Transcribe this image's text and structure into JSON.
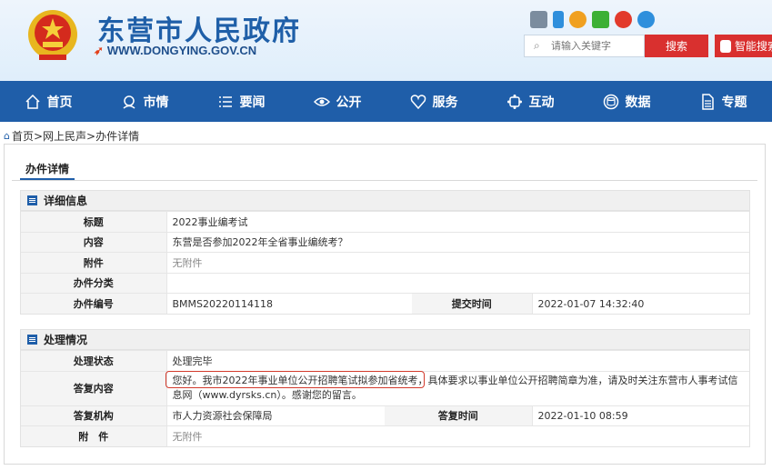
{
  "header": {
    "site_title": "东营市人民政府",
    "site_url": "WWW.DONGYING.GOV.CN",
    "search_placeholder": "请输入关键字",
    "search_button": "搜索",
    "smart_search_button": "智能搜索"
  },
  "social_icons": [
    "app-icon",
    "mobile-icon",
    "share-icon",
    "wechat-icon",
    "weibo-icon",
    "robot-icon"
  ],
  "nav": {
    "items": [
      {
        "label": "首页",
        "icon": "home-icon"
      },
      {
        "label": "市情",
        "icon": "city-icon"
      },
      {
        "label": "要闻",
        "icon": "list-icon"
      },
      {
        "label": "公开",
        "icon": "eye-icon"
      },
      {
        "label": "服务",
        "icon": "heart-icon"
      },
      {
        "label": "互动",
        "icon": "interact-icon"
      },
      {
        "label": "数据",
        "icon": "database-icon"
      },
      {
        "label": "专题",
        "icon": "document-icon"
      }
    ]
  },
  "breadcrumb": "首页>网上民声>办件详情",
  "panel": {
    "tab_label": "办件详情",
    "detail": {
      "heading": "详细信息",
      "title_label": "标题",
      "title_value": "2022事业编考试",
      "content_label": "内容",
      "content_value": "东营是否参加2022年全省事业编统考？",
      "attachment_label": "附件",
      "attachment_value": "无附件",
      "category_label": "办件分类",
      "category_value": "",
      "number_label": "办件编号",
      "number_value": "BMMS20220114118",
      "submit_time_label": "提交时间",
      "submit_time_value": "2022-01-07 14:32:40"
    },
    "processing": {
      "heading": "处理情况",
      "status_label": "处理状态",
      "status_value": "处理完毕",
      "reply_label": "答复内容",
      "reply_value": "您好。我市2022年事业单位公开招聘笔试拟参加省统考，具体要求以事业单位公开招聘简章为准，请及时关注东营市人事考试信息网（www.dyrsks.cn）。感谢您的留言。",
      "org_label": "答复机构",
      "org_value": "市人力资源社会保障局",
      "reply_time_label": "答复时间",
      "reply_time_value": "2022-01-10 08:59",
      "attachment_label": "附　件",
      "attachment_value": "无附件"
    }
  },
  "colors": {
    "nav_bg": "#1f5ea9",
    "accent_red": "#d9302f",
    "title_blue": "#1f5fa8"
  }
}
